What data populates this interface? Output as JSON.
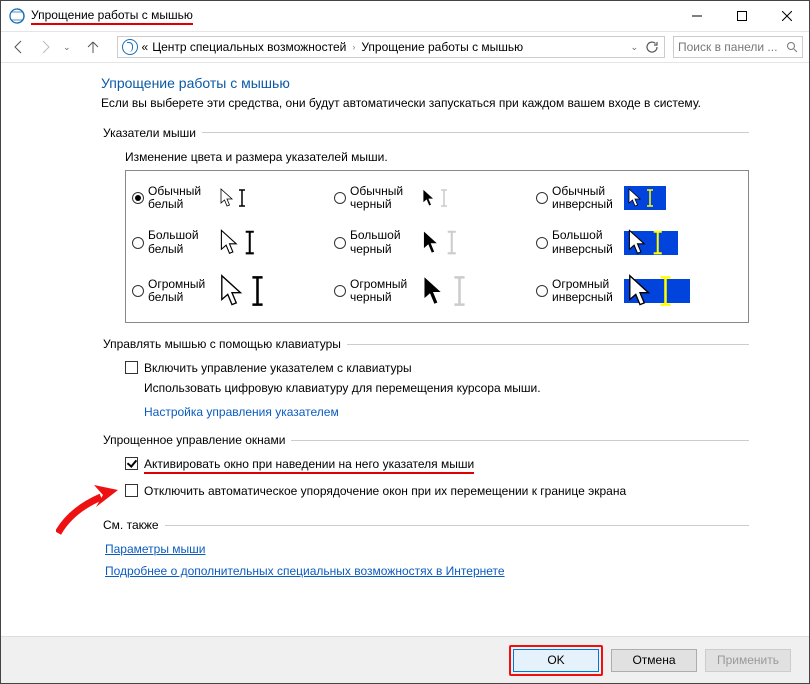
{
  "title": "Упрощение работы с мышью",
  "breadcrumb": {
    "chev_left": "«",
    "part1": "Центр специальных возможностей",
    "part2": "Упрощение работы с мышью"
  },
  "search_placeholder": "Поиск в панели ...",
  "heading": "Упрощение работы с мышью",
  "subtext": "Если вы выберете эти средства, они будут автоматически запускаться при каждом вашем входе в систему.",
  "pointers": {
    "legend": "Указатели мыши",
    "label": "Изменение цвета и размера указателей мыши.",
    "opts": [
      {
        "t1": "Обычный",
        "t2": "белый",
        "sel": true,
        "style": "white",
        "size": "s"
      },
      {
        "t1": "Обычный",
        "t2": "черный",
        "sel": false,
        "style": "black",
        "size": "s"
      },
      {
        "t1": "Обычный",
        "t2": "инверсный",
        "sel": false,
        "style": "inv",
        "size": "s"
      },
      {
        "t1": "Большой",
        "t2": "белый",
        "sel": false,
        "style": "white",
        "size": "m"
      },
      {
        "t1": "Большой",
        "t2": "черный",
        "sel": false,
        "style": "black",
        "size": "m"
      },
      {
        "t1": "Большой",
        "t2": "инверсный",
        "sel": false,
        "style": "inv",
        "size": "m"
      },
      {
        "t1": "Огромный",
        "t2": "белый",
        "sel": false,
        "style": "white",
        "size": "l"
      },
      {
        "t1": "Огромный",
        "t2": "черный",
        "sel": false,
        "style": "black",
        "size": "l"
      },
      {
        "t1": "Огромный",
        "t2": "инверсный",
        "sel": false,
        "style": "inv",
        "size": "l"
      }
    ]
  },
  "keyboard": {
    "legend": "Управлять мышью с помощью клавиатуры",
    "cb_label": "Включить управление указателем с клавиатуры",
    "desc": "Использовать цифровую клавиатуру для перемещения курсора мыши.",
    "link": "Настройка управления указателем"
  },
  "windows": {
    "legend": "Упрощенное управление окнами",
    "cb1": "Активировать окно при наведении на него указателя мыши",
    "cb2": "Отключить автоматическое упорядочение окон при их перемещении к границе экрана"
  },
  "seealso": {
    "legend": "См. также",
    "link1": "Параметры мыши",
    "link2": "Подробнее о дополнительных специальных возможностях в Интернете"
  },
  "buttons": {
    "ok": "OK",
    "cancel": "Отмена",
    "apply": "Применить"
  }
}
